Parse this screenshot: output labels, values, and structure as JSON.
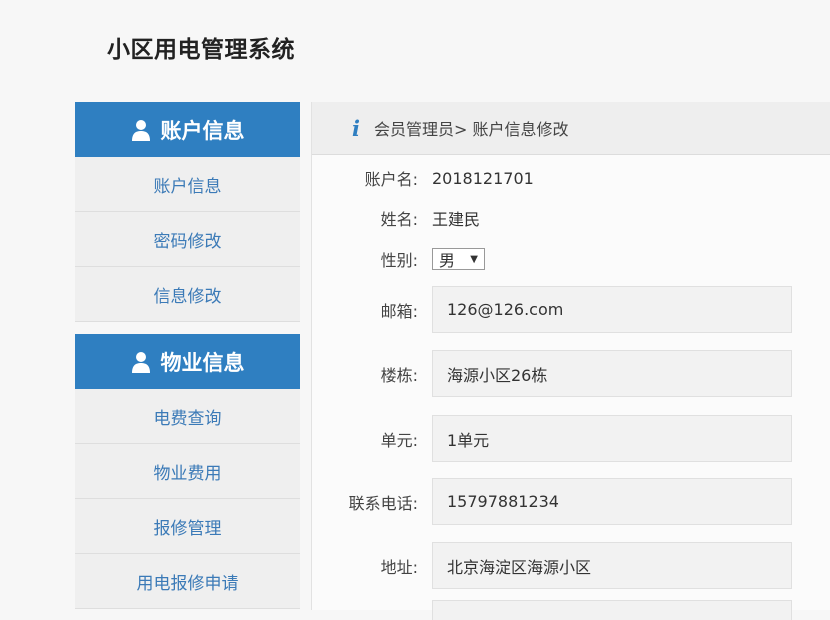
{
  "app": {
    "title": "小区用电管理系统"
  },
  "sidebar": {
    "sections": [
      {
        "icon": "user-icon",
        "title": "账户信息",
        "items": [
          "账户信息",
          "密码修改",
          "信息修改"
        ]
      },
      {
        "icon": "user-icon",
        "title": "物业信息",
        "items": [
          "电费查询",
          "物业费用",
          "报修管理",
          "用电报修申请"
        ]
      }
    ]
  },
  "breadcrumb": {
    "icon": "info-icon",
    "text": "会员管理员> 账户信息修改"
  },
  "form": {
    "account": {
      "label": "账户名:",
      "value": "2018121701"
    },
    "name": {
      "label": "姓名:",
      "value": "王建民"
    },
    "gender": {
      "label": "性别:",
      "value": "男"
    },
    "email": {
      "label": "邮箱:",
      "value": "126@126.com"
    },
    "building": {
      "label": "楼栋:",
      "value": "海源小区26栋"
    },
    "unit": {
      "label": "单元:",
      "value": "1单元"
    },
    "phone": {
      "label": "联系电话:",
      "value": "15797881234"
    },
    "address": {
      "label": "地址:",
      "value": "北京海淀区海源小区"
    }
  },
  "colors": {
    "accent": "#2f7fc1",
    "link": "#3b7ab7"
  }
}
